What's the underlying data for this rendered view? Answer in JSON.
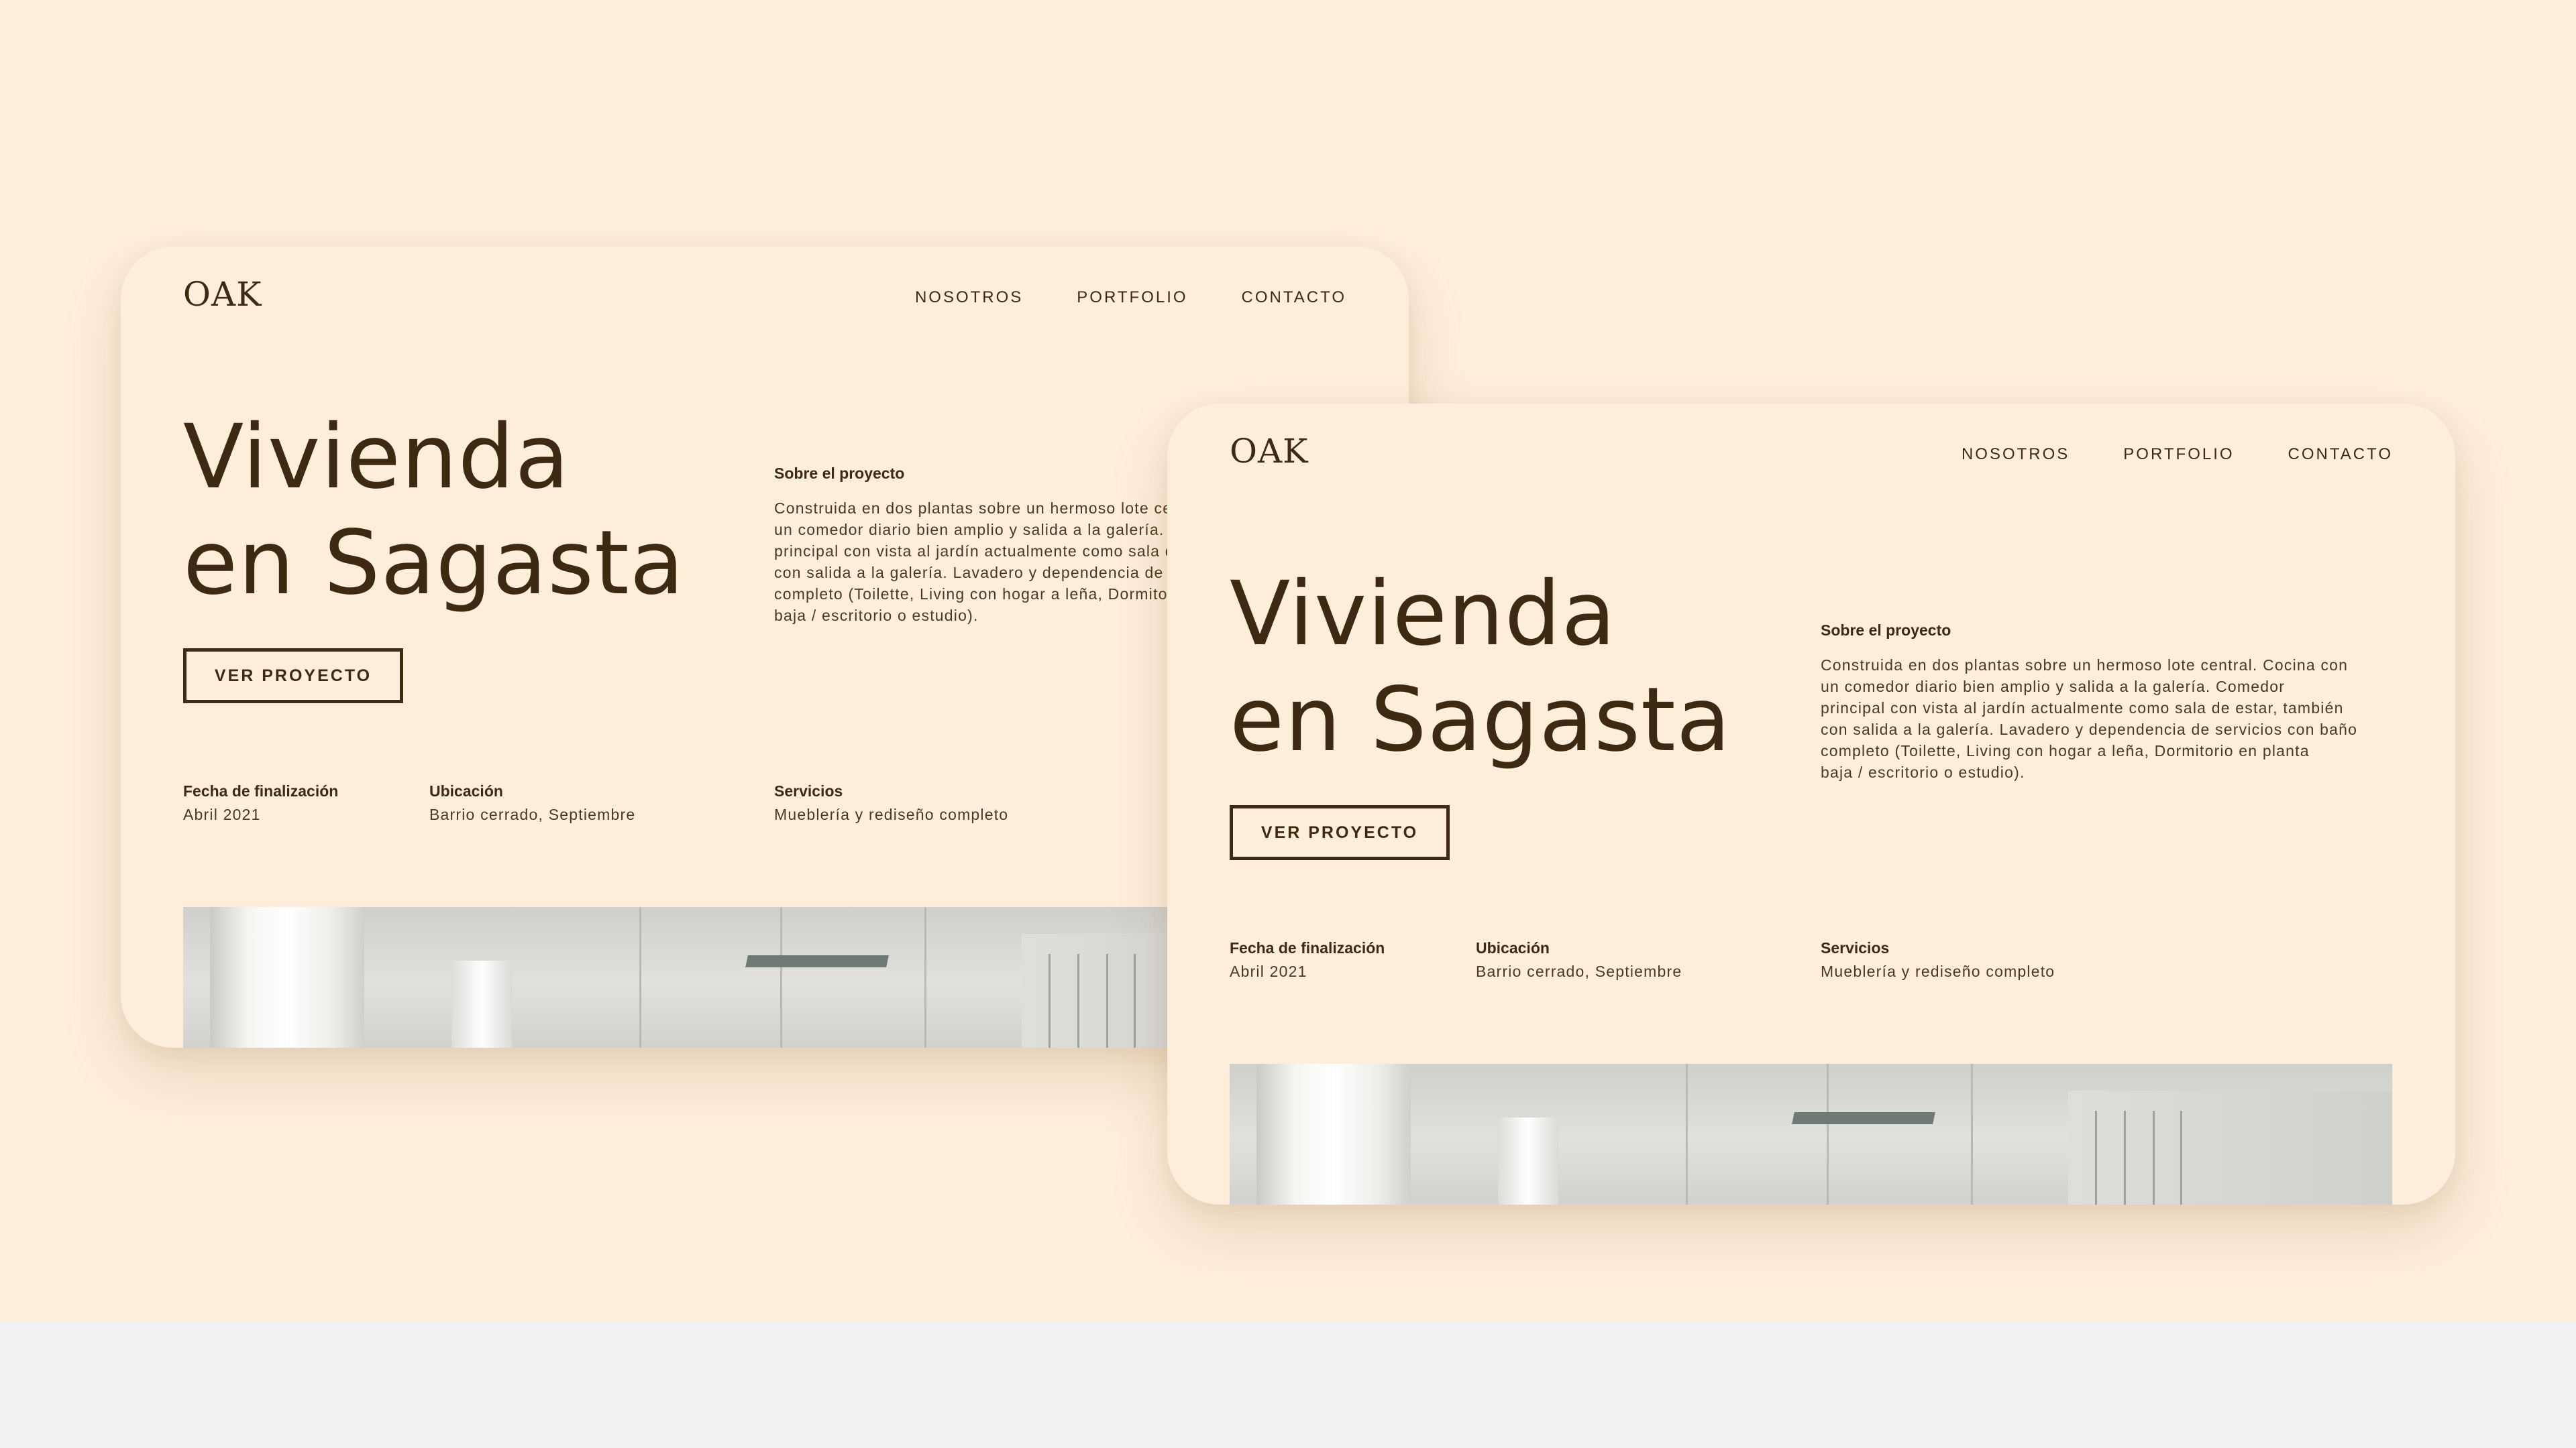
{
  "colors": {
    "background": "#fdeedb",
    "text": "#3e2a12",
    "footer_strip": "#f2f2f2"
  },
  "site": {
    "logo": "OAK",
    "nav": [
      "NOSOTROS",
      "PORTFOLIO",
      "CONTACTO"
    ],
    "title_line1": "Vivienda",
    "title_line2": "en Sagasta",
    "cta": "VER PROYECTO",
    "about_heading": "Sobre el proyecto",
    "about_lines": [
      "Construida en dos plantas sobre un hermoso lote central. Cocina con",
      "un comedor diario bien amplio y salida a la galería. Comedor",
      "principal con vista al jardín actualmente como sala de estar, también",
      "con salida a la galería. Lavadero y dependencia de servicios con baño",
      "completo (Toilette, Living con hogar a leña, Dormitorio en planta",
      "baja / escritorio o estudio)."
    ],
    "meta": [
      {
        "label": "Fecha de finalización",
        "value": "Abril 2021"
      },
      {
        "label": "Ubicación",
        "value": "Barrio cerrado, Septiembre"
      },
      {
        "label": "Servicios",
        "value": "Mueblería y rediseño completo"
      }
    ],
    "photo_alt": "interior-room-photo"
  }
}
